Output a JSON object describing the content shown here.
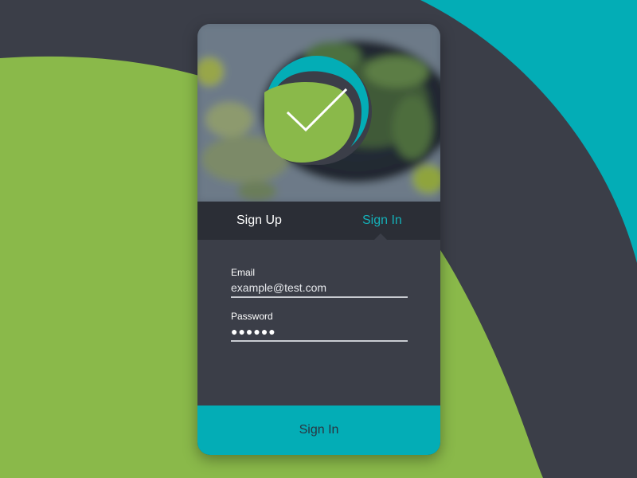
{
  "colors": {
    "background": "#3b3e48",
    "green": "#8ab94a",
    "teal": "#03adb6",
    "tab_bar": "#2b2e36",
    "active_tab": "#14b0b8"
  },
  "logo": {
    "icon": "checkmark-badge-icon"
  },
  "tabs": {
    "sign_up": "Sign Up",
    "sign_in": "Sign In",
    "active": "sign_in"
  },
  "form": {
    "email": {
      "label": "Email",
      "value": "example@test.com"
    },
    "password": {
      "label": "Password",
      "value": "●●●●●●"
    }
  },
  "submit": {
    "label": "Sign In"
  }
}
